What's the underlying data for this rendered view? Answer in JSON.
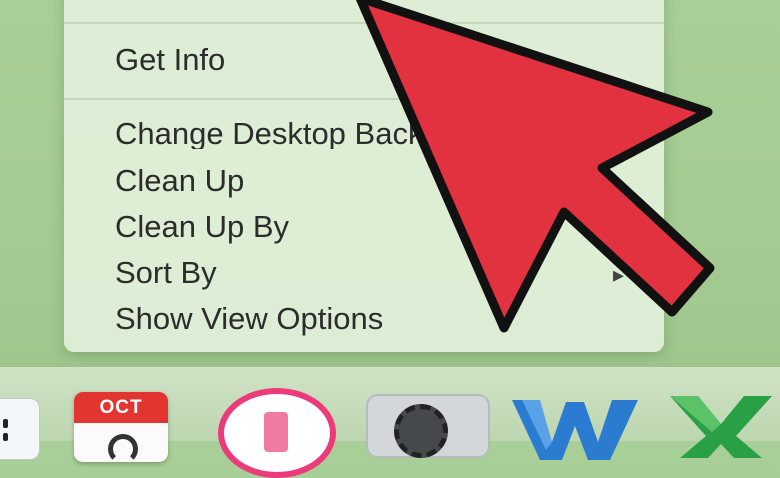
{
  "context_menu": {
    "items": [
      {
        "label": "Get Info"
      },
      {
        "label": "Change Desktop Background..."
      },
      {
        "label": "Clean Up"
      },
      {
        "label": "Clean Up By"
      },
      {
        "label": "Sort By"
      },
      {
        "label": "Show View Options"
      }
    ]
  },
  "dock": {
    "calendar_month": "OCT"
  },
  "icons": {
    "pointer": "red-arrow-pointer",
    "finder": "finder-icon",
    "calendar": "calendar-icon",
    "itunes": "itunes-icon",
    "system_preferences": "system-preferences-icon",
    "word": "word-icon",
    "excel": "excel-icon"
  },
  "colors": {
    "arrow_fill": "#e3323f",
    "menu_bg": "#e2f0da",
    "desktop_green": "#a9cf98"
  }
}
